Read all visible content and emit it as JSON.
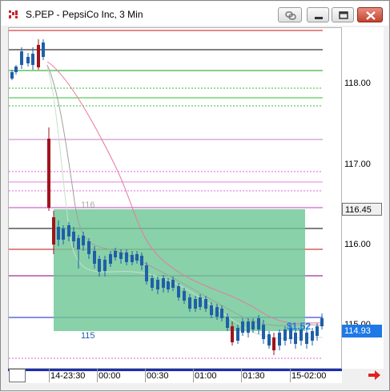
{
  "window": {
    "title": "S.PEP - PepsiCo Inc, 3 Min",
    "buttons": {
      "link": "link-icon",
      "minimize": "minimize-icon",
      "maximize": "maximize-icon",
      "close": "close-icon"
    }
  },
  "price_scale": {
    "labels": [
      "118.00",
      "117.00",
      "116.00",
      "115.00"
    ],
    "current_price": "116.45",
    "last_price": "114.93"
  },
  "time_axis": {
    "labels": [
      "14-23:30",
      "00:00",
      "00:30",
      "01:00",
      "01:30",
      "15-02:00"
    ]
  },
  "chart": {
    "zone_upper_label": "116",
    "zone_lower_label": "115",
    "pnl_label": "$1.52",
    "colors": {
      "zone_fill": "#6cc594",
      "up_candle": "#1f5fa8",
      "down_candle": "#a0141c",
      "last_price_tag": "#1e78e6"
    }
  }
}
